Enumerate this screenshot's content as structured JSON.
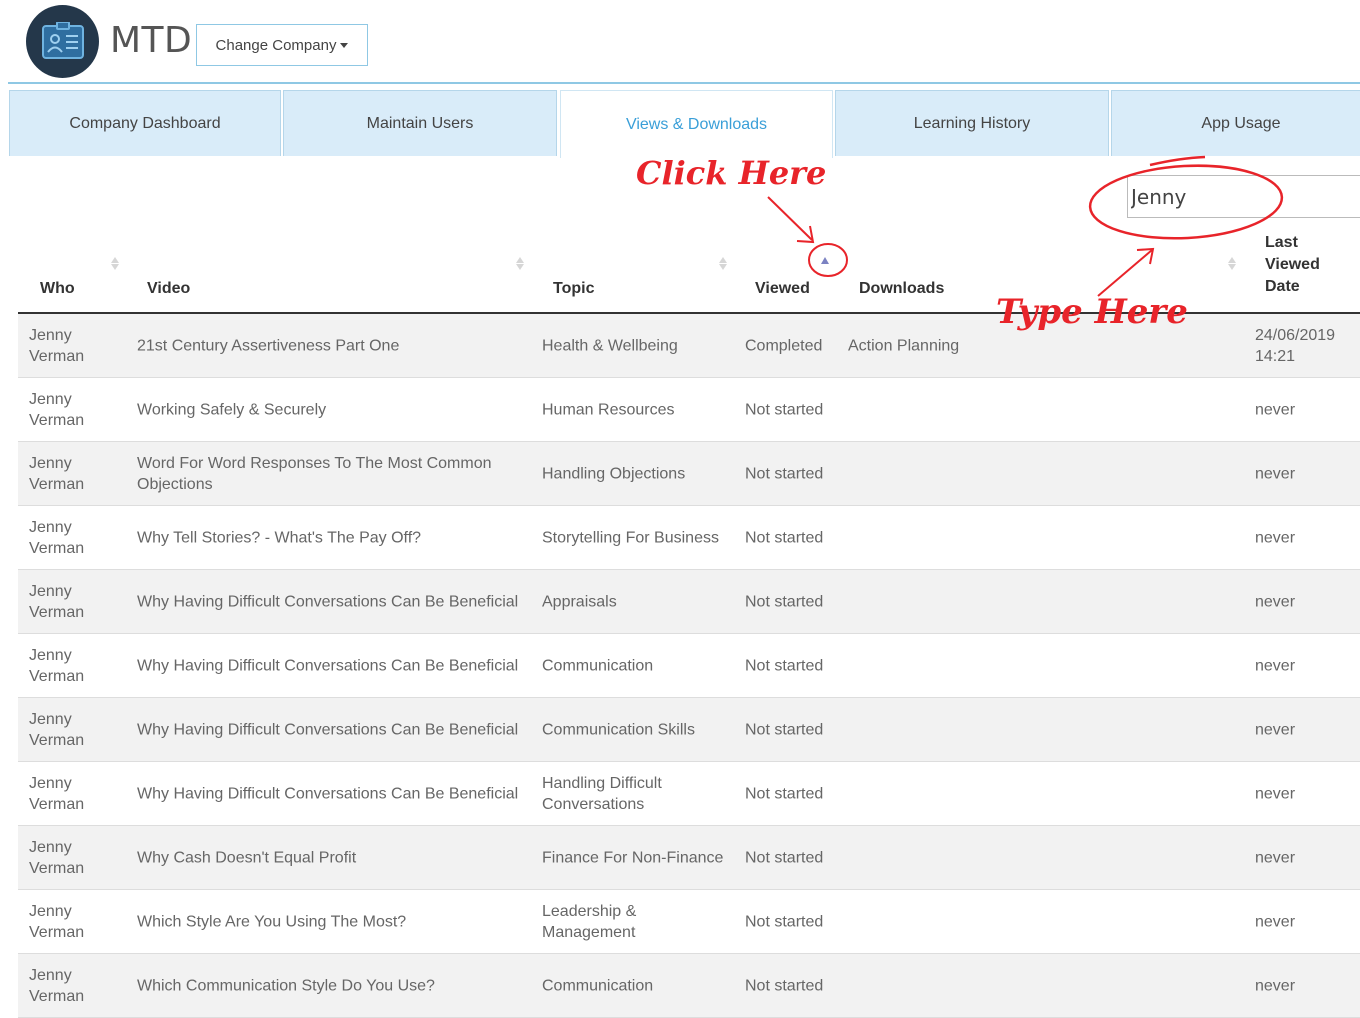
{
  "header": {
    "app_title": "MTD",
    "change_company_label": "Change Company"
  },
  "tabs": [
    {
      "label": "Company Dashboard",
      "active": false
    },
    {
      "label": "Maintain Users",
      "active": false
    },
    {
      "label": "Views & Downloads",
      "active": true
    },
    {
      "label": "Learning History",
      "active": false
    },
    {
      "label": "App Usage",
      "active": false
    }
  ],
  "search": {
    "value": "Jenny"
  },
  "annotations": {
    "click_here": "Click Here",
    "type_here": "Type Here"
  },
  "table": {
    "columns": {
      "who": "Who",
      "video": "Video",
      "topic": "Topic",
      "viewed": "Viewed",
      "downloads": "Downloads",
      "last_viewed_1": "Last",
      "last_viewed_2": "Viewed",
      "last_viewed_3": "Date"
    },
    "sorted_column": "viewed",
    "sort_direction": "ascending",
    "rows": [
      {
        "who_first": "Jenny",
        "who_last": "Verman",
        "video": "21st Century Assertiveness Part One",
        "topic": "Health & Wellbeing",
        "viewed": "Completed",
        "downloads": "Action Planning",
        "date": "24/06/2019",
        "time": "14:21"
      },
      {
        "who_first": "Jenny",
        "who_last": "Verman",
        "video": "Working Safely & Securely",
        "topic": "Human Resources",
        "viewed": "Not started",
        "downloads": "",
        "date": "never",
        "time": ""
      },
      {
        "who_first": "Jenny",
        "who_last": "Verman",
        "video": "Word For Word Responses To The Most Common Objections",
        "topic": "Handling Objections",
        "viewed": "Not started",
        "downloads": "",
        "date": "never",
        "time": ""
      },
      {
        "who_first": "Jenny",
        "who_last": "Verman",
        "video": "Why Tell Stories? - What's The Pay Off?",
        "topic": "Storytelling For Business",
        "viewed": "Not started",
        "downloads": "",
        "date": "never",
        "time": ""
      },
      {
        "who_first": "Jenny",
        "who_last": "Verman",
        "video": "Why Having Difficult Conversations Can Be Beneficial",
        "topic": "Appraisals",
        "viewed": "Not started",
        "downloads": "",
        "date": "never",
        "time": ""
      },
      {
        "who_first": "Jenny",
        "who_last": "Verman",
        "video": "Why Having Difficult Conversations Can Be Beneficial",
        "topic": "Communication",
        "viewed": "Not started",
        "downloads": "",
        "date": "never",
        "time": ""
      },
      {
        "who_first": "Jenny",
        "who_last": "Verman",
        "video": "Why Having Difficult Conversations Can Be Beneficial",
        "topic": "Communication Skills",
        "viewed": "Not started",
        "downloads": "",
        "date": "never",
        "time": ""
      },
      {
        "who_first": "Jenny",
        "who_last": "Verman",
        "video": "Why Having Difficult Conversations Can Be Beneficial",
        "topic": "Handling Difficult Conversations",
        "viewed": "Not started",
        "downloads": "",
        "date": "never",
        "time": ""
      },
      {
        "who_first": "Jenny",
        "who_last": "Verman",
        "video": "Why Cash Doesn't Equal Profit",
        "topic": "Finance For Non-Finance",
        "viewed": "Not started",
        "downloads": "",
        "date": "never",
        "time": ""
      },
      {
        "who_first": "Jenny",
        "who_last": "Verman",
        "video": "Which Style Are You Using The Most?",
        "topic": "Leadership & Management",
        "viewed": "Not started",
        "downloads": "",
        "date": "never",
        "time": ""
      },
      {
        "who_first": "Jenny",
        "who_last": "Verman",
        "video": "Which Communication Style Do You Use?",
        "topic": "Communication",
        "viewed": "Not started",
        "downloads": "",
        "date": "never",
        "time": ""
      }
    ]
  },
  "colors": {
    "accent": "#3a9fd8",
    "tab_bg": "#d9ecf9",
    "logo_bg": "#24374a",
    "annotation": "#e8242a",
    "sort_active": "#7b82c2"
  }
}
